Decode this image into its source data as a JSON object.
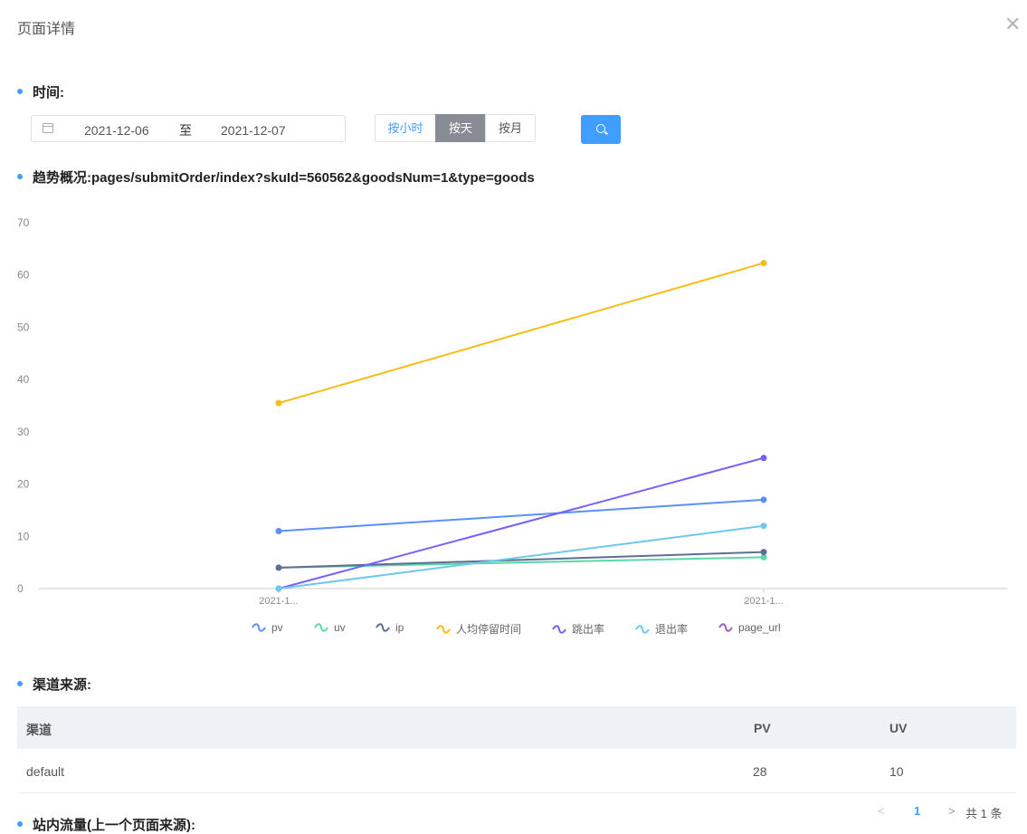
{
  "modal": {
    "title": "页面详情",
    "close_glyph": "✕"
  },
  "time_section": {
    "title": "时间:"
  },
  "date_range": {
    "start": "2021-12-06",
    "separator": "至",
    "end": "2021-12-07"
  },
  "granularity": {
    "options": [
      "按小时",
      "按天",
      "按月"
    ],
    "selected": "按天"
  },
  "trend_section": {
    "title": "趋势概况:pages/submitOrder/index?skuId=560562&goodsNum=1&type=goods"
  },
  "chart_data": {
    "type": "line",
    "categories": [
      "2021-1...",
      "2021-1..."
    ],
    "ylim": [
      0,
      70
    ],
    "yticks": [
      0,
      10,
      20,
      30,
      40,
      50,
      60,
      70
    ],
    "grid": false,
    "legend_position": "bottom",
    "series": [
      {
        "name": "pv",
        "values": [
          11,
          17
        ],
        "color": "#5b8ff9"
      },
      {
        "name": "uv",
        "values": [
          4,
          6
        ],
        "color": "#5ad8a6"
      },
      {
        "name": "ip",
        "values": [
          4,
          7
        ],
        "color": "#5d7092"
      },
      {
        "name": "人均停留时间",
        "values": [
          35.5,
          62.3
        ],
        "color": "#f6bd16"
      },
      {
        "name": "跳出率",
        "values": [
          0,
          25
        ],
        "color": "#7262fd"
      },
      {
        "name": "退出率",
        "values": [
          0,
          12
        ],
        "color": "#6dc8ec"
      },
      {
        "name": "page_url",
        "values": [
          null,
          null
        ],
        "color": "#9661bc"
      }
    ]
  },
  "channel_section": {
    "title": "渠道来源:"
  },
  "channel_table": {
    "columns": [
      "渠道",
      "PV",
      "UV"
    ],
    "rows": [
      {
        "channel": "default",
        "pv": "28",
        "uv": "10"
      }
    ]
  },
  "pagination": {
    "prev_glyph": "<",
    "current": "1",
    "next_glyph": ">",
    "total": "共 1 条"
  },
  "internal_section": {
    "title": "站内流量(上一个页面来源):"
  },
  "colors": {
    "accent": "#409eff",
    "active_segment": "#888d95",
    "table_header_bg": "#eef1f6"
  }
}
